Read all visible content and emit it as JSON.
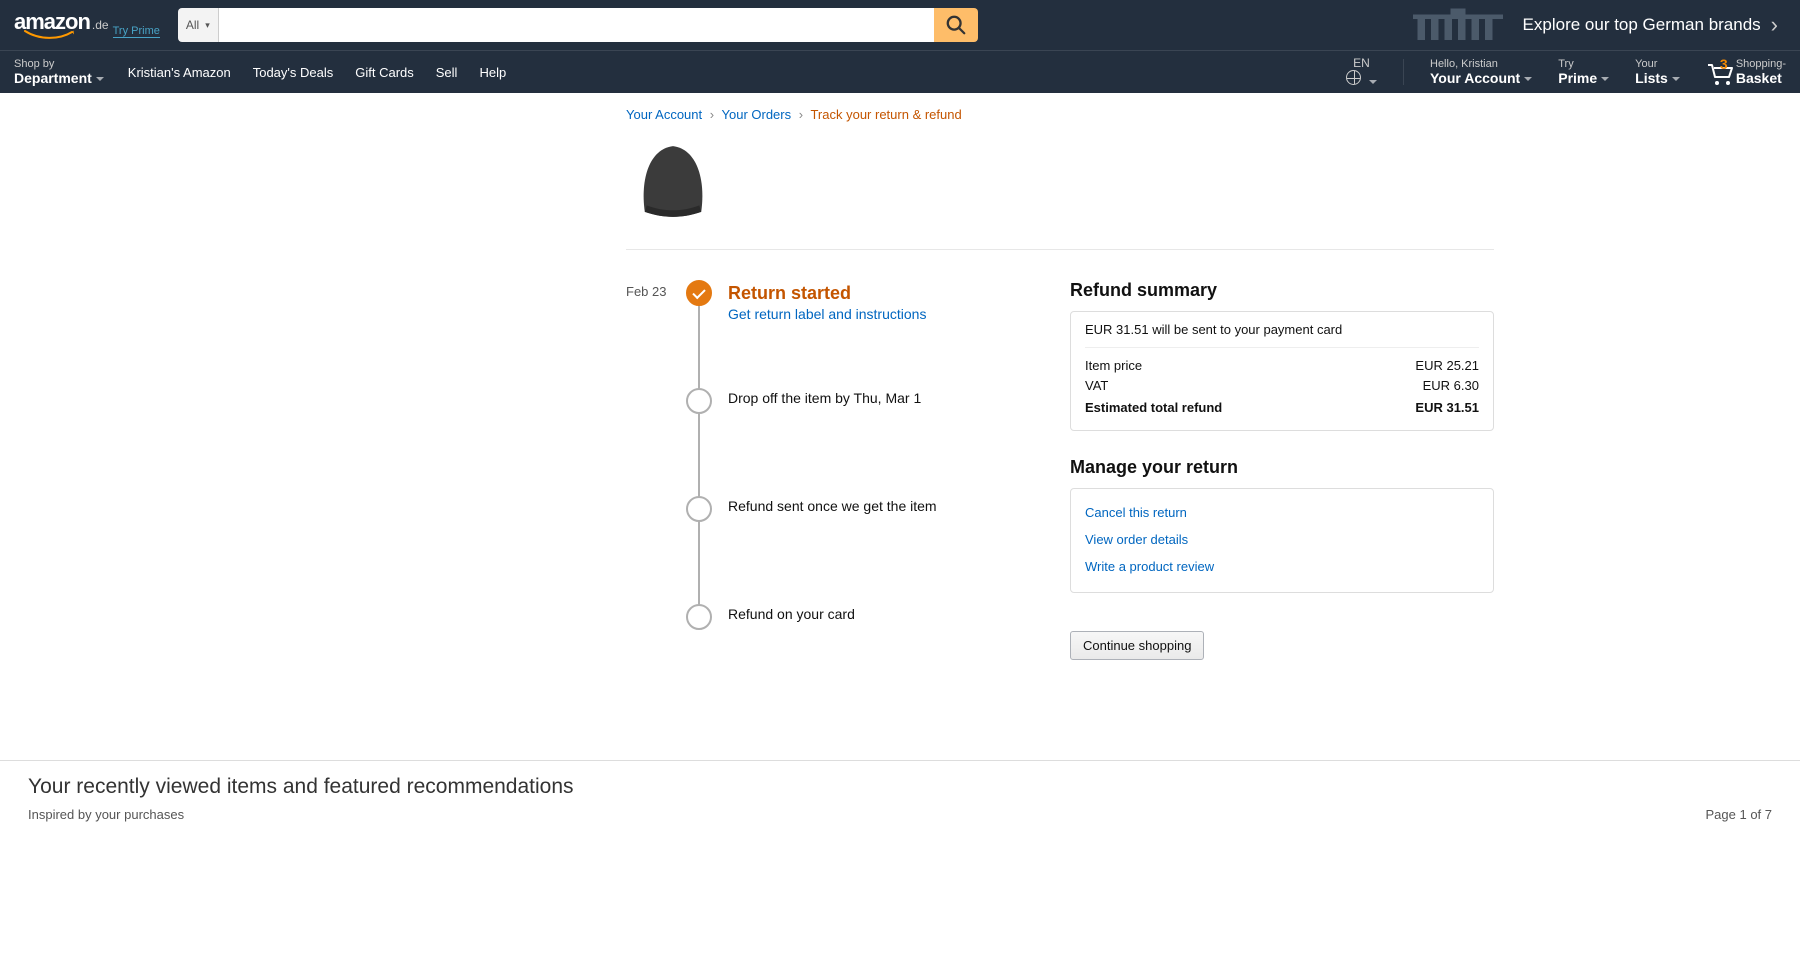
{
  "header": {
    "logo_text": "amazon",
    "logo_domain": ".de",
    "logo_tryprime": "Try Prime",
    "search_dd": "All",
    "brands_promo": "Explore our top German brands",
    "dept_top": "Shop by",
    "dept_bottom": "Department",
    "nav_links": [
      "Kristian's Amazon",
      "Today's Deals",
      "Gift Cards",
      "Sell",
      "Help"
    ],
    "lang": "EN",
    "account_top": "Hello, Kristian",
    "account_bottom": "Your Account",
    "prime_top": "Try",
    "prime_bottom": "Prime",
    "lists_top": "Your",
    "lists_bottom": "Lists",
    "cart_count": "3",
    "cart_top": "Shopping-",
    "cart_bottom": "Basket"
  },
  "breadcrumb": {
    "a1": "Your Account",
    "a2": "Your Orders",
    "current": "Track your return & refund"
  },
  "timeline": {
    "date": "Feb 23",
    "step1_title": "Return started",
    "step1_link": "Get return label and instructions",
    "step2": "Drop off the item by Thu, Mar 1",
    "step3": "Refund sent once we get the item",
    "step4": "Refund on your card"
  },
  "refund": {
    "title": "Refund summary",
    "topline": "EUR 31.51 will be sent to your payment card",
    "item_price_label": "Item price",
    "item_price_value": "EUR 25.21",
    "vat_label": "VAT",
    "vat_value": "EUR 6.30",
    "total_label": "Estimated total refund",
    "total_value": "EUR 31.51"
  },
  "manage": {
    "title": "Manage your return",
    "link1": "Cancel this return",
    "link2": "View order details",
    "link3": "Write a product review"
  },
  "continue_label": "Continue shopping",
  "rvi": {
    "title": "Your recently viewed items and featured recommendations",
    "sub": "Inspired by your purchases",
    "page": "Page 1 of 7"
  }
}
